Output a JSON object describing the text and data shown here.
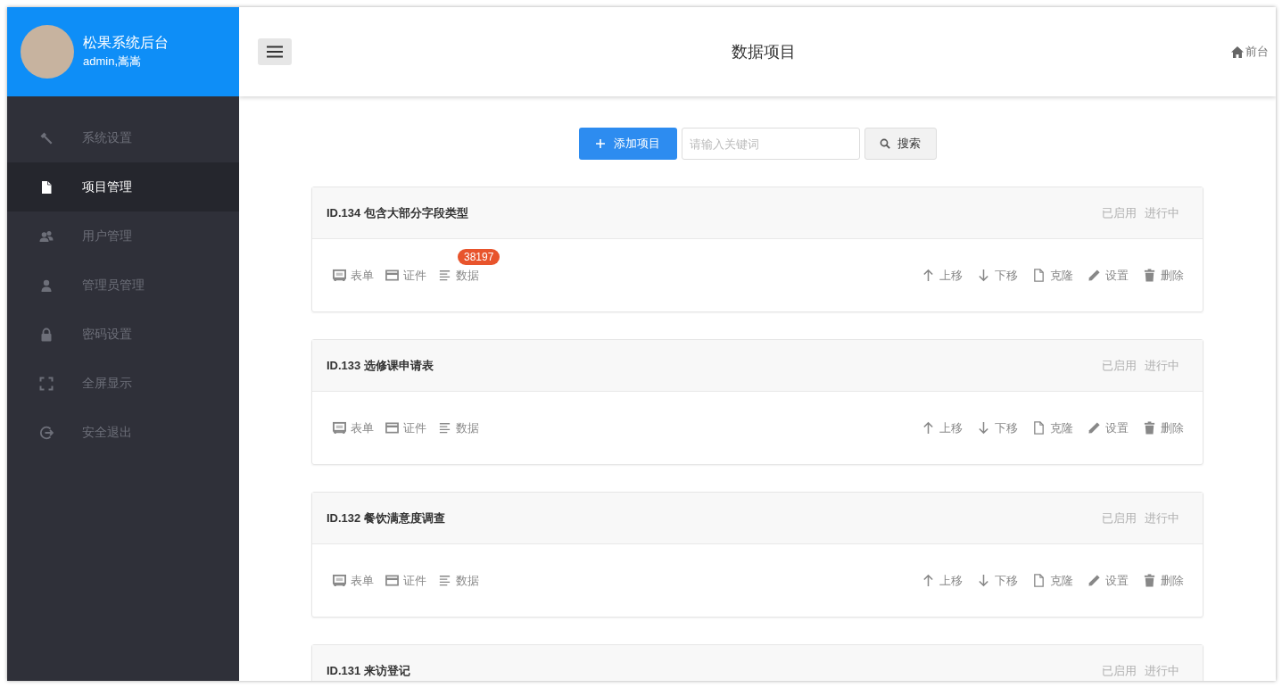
{
  "sidebar": {
    "brand": {
      "title": "松果系统后台",
      "user": "admin,嵩嵩"
    },
    "items": [
      {
        "kind": "hammer",
        "label": "系统设置",
        "selected": false
      },
      {
        "kind": "file",
        "label": "项目管理",
        "selected": true
      },
      {
        "kind": "users",
        "label": "用户管理",
        "selected": false
      },
      {
        "kind": "user",
        "label": "管理员管理",
        "selected": false
      },
      {
        "kind": "lock",
        "label": "密码设置",
        "selected": false
      },
      {
        "kind": "fullscreen",
        "label": "全屏显示",
        "selected": false
      },
      {
        "kind": "logout",
        "label": "安全退出",
        "selected": false
      }
    ]
  },
  "topbar": {
    "title": "数据项目",
    "home_link": "前台"
  },
  "toolbar": {
    "add_button": "添加项目",
    "search": {
      "placeholder": "请输入关键词"
    },
    "search_button": "搜索"
  },
  "projects": [
    {
      "title": "ID.134 包含大部分字段类型",
      "tags": [
        "已启用",
        "进行中"
      ],
      "links": [
        {
          "kind": "form",
          "label": "表单"
        },
        {
          "kind": "card",
          "label": "证件"
        },
        {
          "kind": "data",
          "label": "数据",
          "badge": "38197"
        }
      ],
      "actions": [
        {
          "kind": "up",
          "label": "上移"
        },
        {
          "kind": "down",
          "label": "下移"
        },
        {
          "kind": "clone",
          "label": "克隆"
        },
        {
          "kind": "edit",
          "label": "设置"
        },
        {
          "kind": "delete",
          "label": "删除"
        }
      ]
    },
    {
      "title": "ID.133 选修课申请表",
      "tags": [
        "已启用",
        "进行中"
      ],
      "links": [
        {
          "kind": "form",
          "label": "表单"
        },
        {
          "kind": "card",
          "label": "证件"
        },
        {
          "kind": "data",
          "label": "数据"
        }
      ],
      "actions": [
        {
          "kind": "up",
          "label": "上移"
        },
        {
          "kind": "down",
          "label": "下移"
        },
        {
          "kind": "clone",
          "label": "克隆"
        },
        {
          "kind": "edit",
          "label": "设置"
        },
        {
          "kind": "delete",
          "label": "删除"
        }
      ]
    },
    {
      "title": "ID.132 餐饮满意度调查",
      "tags": [
        "已启用",
        "进行中"
      ],
      "links": [
        {
          "kind": "form",
          "label": "表单"
        },
        {
          "kind": "card",
          "label": "证件"
        },
        {
          "kind": "data",
          "label": "数据"
        }
      ],
      "actions": [
        {
          "kind": "up",
          "label": "上移"
        },
        {
          "kind": "down",
          "label": "下移"
        },
        {
          "kind": "clone",
          "label": "克隆"
        },
        {
          "kind": "edit",
          "label": "设置"
        },
        {
          "kind": "delete",
          "label": "删除"
        }
      ]
    },
    {
      "title": "ID.131 来访登记",
      "tags": [
        "已启用",
        "进行中"
      ]
    }
  ]
}
